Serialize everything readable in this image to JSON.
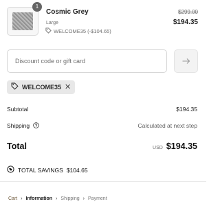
{
  "cart_item": {
    "quantity": "1",
    "name": "Cosmic Grey",
    "variant": "Large",
    "discount_line": "WELCOME35 (-$104.65)",
    "original_price": "$299.00",
    "price": "$194.35"
  },
  "discount": {
    "placeholder": "Discount code or gift card",
    "value": "",
    "applied_code": "WELCOME35"
  },
  "summary": {
    "subtotal_label": "Subtotal",
    "subtotal_value": "$194.35",
    "shipping_label": "Shipping",
    "shipping_value": "Calculated at next step",
    "total_label": "Total",
    "currency": "USD",
    "total_value": "$194.35",
    "savings_label": "TOTAL SAVINGS",
    "savings_value": "$104.65"
  },
  "breadcrumb": {
    "items": [
      "Cart",
      "Information",
      "Shipping",
      "Payment"
    ]
  },
  "colors": {
    "accent_link": "#6f5a3c",
    "badge": "#666666",
    "tag_bg": "#e8e8e8"
  }
}
